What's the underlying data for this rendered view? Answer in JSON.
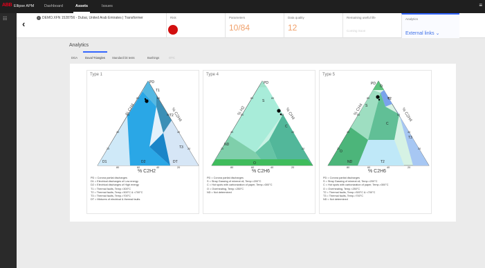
{
  "topbar": {
    "logo": "ABB",
    "app_name": "Ellipse APM",
    "nav": [
      "Dashboard",
      "Assets",
      "Issues"
    ],
    "menu_icon": "≡"
  },
  "header": {
    "asset_title": "DEMO.XFN 1528756 - Dubai, United Arab Emirates | Transformer",
    "risk_label": "Risk",
    "risk_color": "#d20f0f",
    "parameters_label": "Parameters",
    "parameters_value": "10/84",
    "data_quality_label": "Data quality",
    "data_quality_value": "12",
    "rul_label": "Remaining useful life",
    "rul_value": "Coming Soon",
    "analytics_label": "Analytics",
    "external_links": "External links ⌄"
  },
  "section": {
    "title": "Analytics",
    "tabs": [
      "DGA",
      "Duval Triangles",
      "Standard bit tests",
      "Bushings",
      "OTC"
    ],
    "active_tab": "Duval Triangles"
  },
  "colors": {
    "accent": "#3366ff",
    "kpi_value": "#f0a06a",
    "risk_red": "#d20f0f"
  },
  "cards": [
    {
      "title": "Type 1",
      "axis_bottom": "% C2H2",
      "axis_left": "% CH4",
      "axis_right": "% C2H4",
      "zones": [
        "PD",
        "T1",
        "T2",
        "T3",
        "D1",
        "D2",
        "DT"
      ],
      "ticks_left": [
        "20",
        "40",
        "60",
        "80"
      ],
      "ticks_right": [
        "80",
        "60",
        "40",
        "20"
      ],
      "ticks_bottom": [
        "80",
        "60",
        "40",
        "20"
      ],
      "legend": [
        "PD = Corona partial discharges",
        "D1 = Electrical discharges of Low energy",
        "D2 = Electrical discharges of High energy",
        "T1 = Thermal faults, Temp.<300°C",
        "T2 = Thermal faults, Temp.>300°C & <700°C",
        "T3 = Thermal faults, Temp.>700°C",
        "DT = Mixtures of electrical & thermal faults"
      ]
    },
    {
      "title": "Type 4",
      "axis_bottom": "% C2H6",
      "axis_left": "% H2",
      "axis_right": "% CH4",
      "zones": [
        "PD",
        "S",
        "C",
        "ND",
        "O"
      ],
      "ticks_left": [
        "20",
        "40",
        "60",
        "80"
      ],
      "ticks_right": [
        "80",
        "60",
        "40",
        "20"
      ],
      "ticks_bottom": [
        "80",
        "60",
        "40",
        "20"
      ],
      "legend": [
        "PD = Corona partial discharges",
        "S  = Stray Gassing of mineral oil, Temp.<200°C",
        "C  = Hot spots with carbonization of paper, Temp.>300°C",
        "O  = Overheating, Temp.<250°C",
        "ND = Not determined"
      ]
    },
    {
      "title": "Type 5",
      "axis_bottom": "% C2H6",
      "axis_left": "% CH4",
      "axis_right": "% C2H4",
      "zones": [
        "PD",
        "O",
        "T2",
        "S",
        "C",
        "T3",
        "ND",
        "T2",
        "O"
      ],
      "ticks_left": [
        "20",
        "40",
        "60",
        "80"
      ],
      "ticks_right": [
        "80",
        "60",
        "40",
        "20"
      ],
      "ticks_bottom": [
        "80",
        "60",
        "40",
        "20"
      ],
      "legend": [
        "PD = Corona partial discharges",
        "S  = Stray Gassing of mineral oil, Temp.<200°C",
        "C  = Hot spots with carbonization of paper, Temp.>300°C",
        "O  = Overheating, Temp.<250°C",
        "T2 = Thermal faults, Temp.>300°C & <700°C",
        "T3 = Thermal faults, Temp.>700°C",
        "ND = Not determined"
      ]
    }
  ]
}
